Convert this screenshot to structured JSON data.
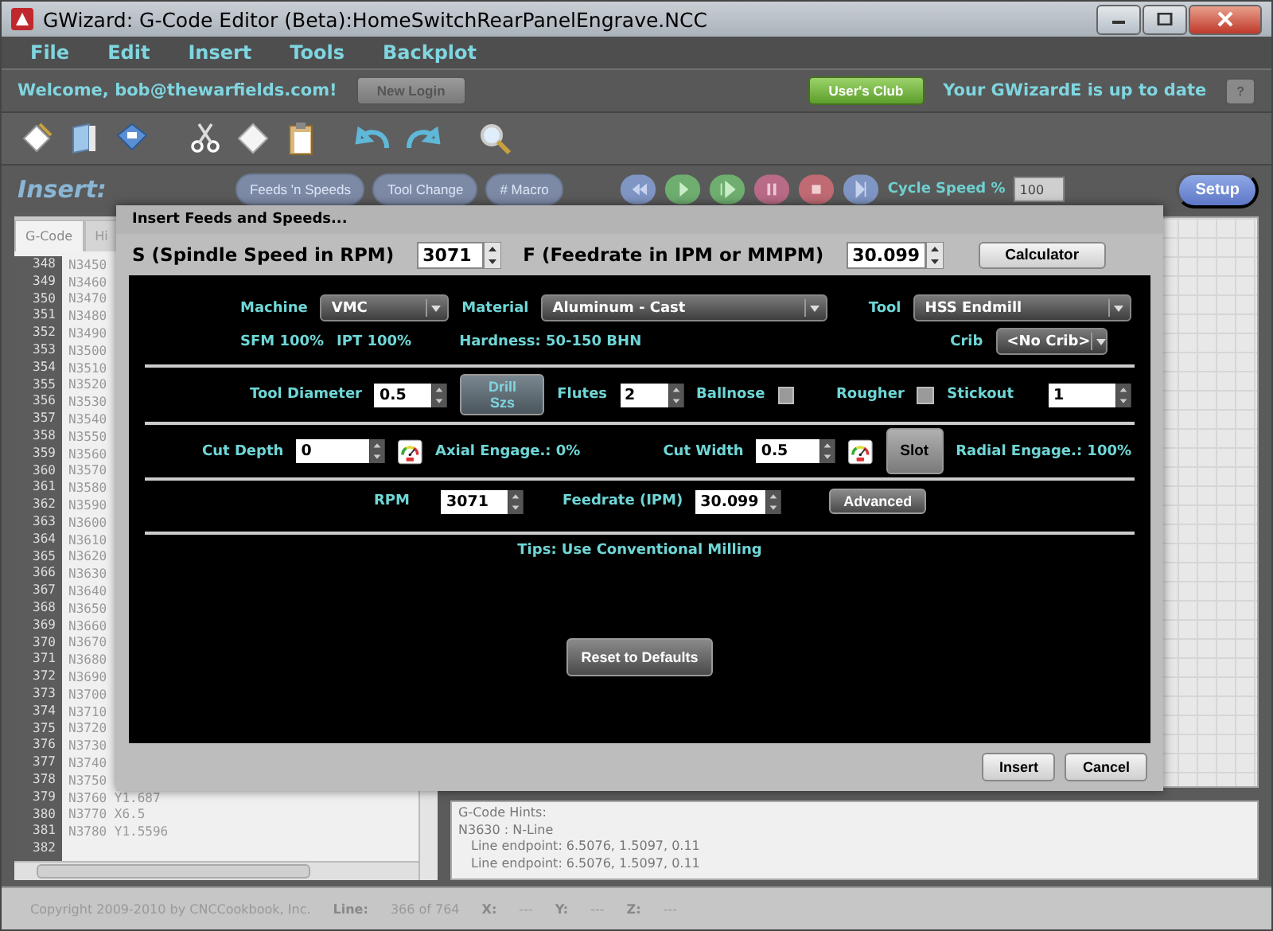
{
  "window": {
    "title": "GWizard: G-Code Editor (Beta):HomeSwitchRearPanelEngrave.NCC"
  },
  "menu": [
    "File",
    "Edit",
    "Insert",
    "Tools",
    "Backplot"
  ],
  "account_bar": {
    "welcome": "Welcome, bob@thewarfields.com!",
    "new_login": "New Login",
    "users_club": "User's Club",
    "update_status": "Your GWizardE is up to date",
    "help": "?"
  },
  "insert_bar": {
    "label": "Insert:",
    "buttons": [
      "Feeds 'n Speeds",
      "Tool Change",
      "# Macro"
    ],
    "cycle_speed_label": "Cycle Speed %",
    "cycle_speed": "100",
    "setup": "Setup"
  },
  "editor": {
    "tabs": [
      {
        "label": "G-Code",
        "selected": true
      },
      {
        "label": "Hi",
        "selected": false
      }
    ],
    "lines": [
      {
        "number": "348",
        "code": "N3450"
      },
      {
        "number": "349",
        "code": "N3460"
      },
      {
        "number": "350",
        "code": "N3470"
      },
      {
        "number": "351",
        "code": "N3480"
      },
      {
        "number": "352",
        "code": "N3490"
      },
      {
        "number": "353",
        "code": "N3500"
      },
      {
        "number": "354",
        "code": "N3510"
      },
      {
        "number": "355",
        "code": "N3520"
      },
      {
        "number": "356",
        "code": "N3530"
      },
      {
        "number": "357",
        "code": "N3540"
      },
      {
        "number": "358",
        "code": "N3550"
      },
      {
        "number": "359",
        "code": "N3560"
      },
      {
        "number": "360",
        "code": "N3570"
      },
      {
        "number": "361",
        "code": "N3580"
      },
      {
        "number": "362",
        "code": "N3590"
      },
      {
        "number": "363",
        "code": "N3600"
      },
      {
        "number": "364",
        "code": "N3610"
      },
      {
        "number": "365",
        "code": "N3620"
      },
      {
        "number": "366",
        "code": "N3630"
      },
      {
        "number": "367",
        "code": "N3640"
      },
      {
        "number": "368",
        "code": "N3650"
      },
      {
        "number": "369",
        "code": "N3660"
      },
      {
        "number": "370",
        "code": "N3670"
      },
      {
        "number": "371",
        "code": "N3680"
      },
      {
        "number": "372",
        "code": "N3690"
      },
      {
        "number": "373",
        "code": "N3700"
      },
      {
        "number": "374",
        "code": "N3710"
      },
      {
        "number": "375",
        "code": "N3720"
      },
      {
        "number": "376",
        "code": "N3730"
      },
      {
        "number": "377",
        "code": "N3740"
      },
      {
        "number": "378",
        "code": "N3750"
      },
      {
        "number": "379",
        "code": "N3760 Y1.687"
      },
      {
        "number": "380",
        "code": "N3770 X6.5"
      },
      {
        "number": "381",
        "code": "N3780 Y1.5596"
      },
      {
        "number": "382"
      }
    ]
  },
  "hints": {
    "title": "G-Code Hints:",
    "lines": [
      "N3630 : N-Line",
      "Line endpoint: 6.5076, 1.5097, 0.11",
      "Line endpoint: 6.5076, 1.5097, 0.11"
    ]
  },
  "status_bar": {
    "copyright": "Copyright 2009-2010 by CNCCookbook, Inc.",
    "line_label": "Line:",
    "line_value": "366 of 764",
    "coords": [
      {
        "label": "X:",
        "value": "---"
      },
      {
        "label": "Y:",
        "value": "---"
      },
      {
        "label": "Z:",
        "value": "---"
      }
    ]
  },
  "dialog": {
    "title": "Insert Feeds and Speeds...",
    "spindle": {
      "label": "S (Spindle Speed in RPM)",
      "value": "3071"
    },
    "feed": {
      "label": "F (Feedrate in IPM or MMPM)",
      "value": "30.099"
    },
    "calculator": "Calculator",
    "machine": {
      "label": "Machine",
      "value": "VMC"
    },
    "material": {
      "label": "Material",
      "value": "Aluminum - Cast"
    },
    "tool": {
      "label": "Tool",
      "value": "HSS Endmill"
    },
    "sfm": "SFM 100%",
    "ipt": "IPT 100%",
    "hardness": "Hardness: 50-150 BHN",
    "crib": {
      "label": "Crib",
      "value": "<No Crib>"
    },
    "tool_diameter": {
      "label": "Tool Diameter",
      "value": "0.5"
    },
    "drill_sizes": "Drill Szs",
    "flutes": {
      "label": "Flutes",
      "value": "2"
    },
    "ballnose": {
      "label": "Ballnose",
      "checked": false
    },
    "rougher": {
      "label": "Rougher",
      "checked": false
    },
    "stickout": {
      "label": "Stickout",
      "value": "1"
    },
    "cut_depth": {
      "label": "Cut Depth",
      "value": "0"
    },
    "axial": "Axial Engage.: 0%",
    "cut_width": {
      "label": "Cut Width",
      "value": "0.5"
    },
    "slot": "Slot",
    "radial": "Radial Engage.: 100%",
    "rpm": {
      "label": "RPM",
      "value": "3071"
    },
    "feedrate": {
      "label": "Feedrate (IPM)",
      "value": "30.099"
    },
    "advanced": "Advanced",
    "tips": "Tips:  Use Conventional Milling",
    "reset": "Reset to Defaults",
    "buttons": [
      "Insert",
      "Cancel"
    ]
  }
}
